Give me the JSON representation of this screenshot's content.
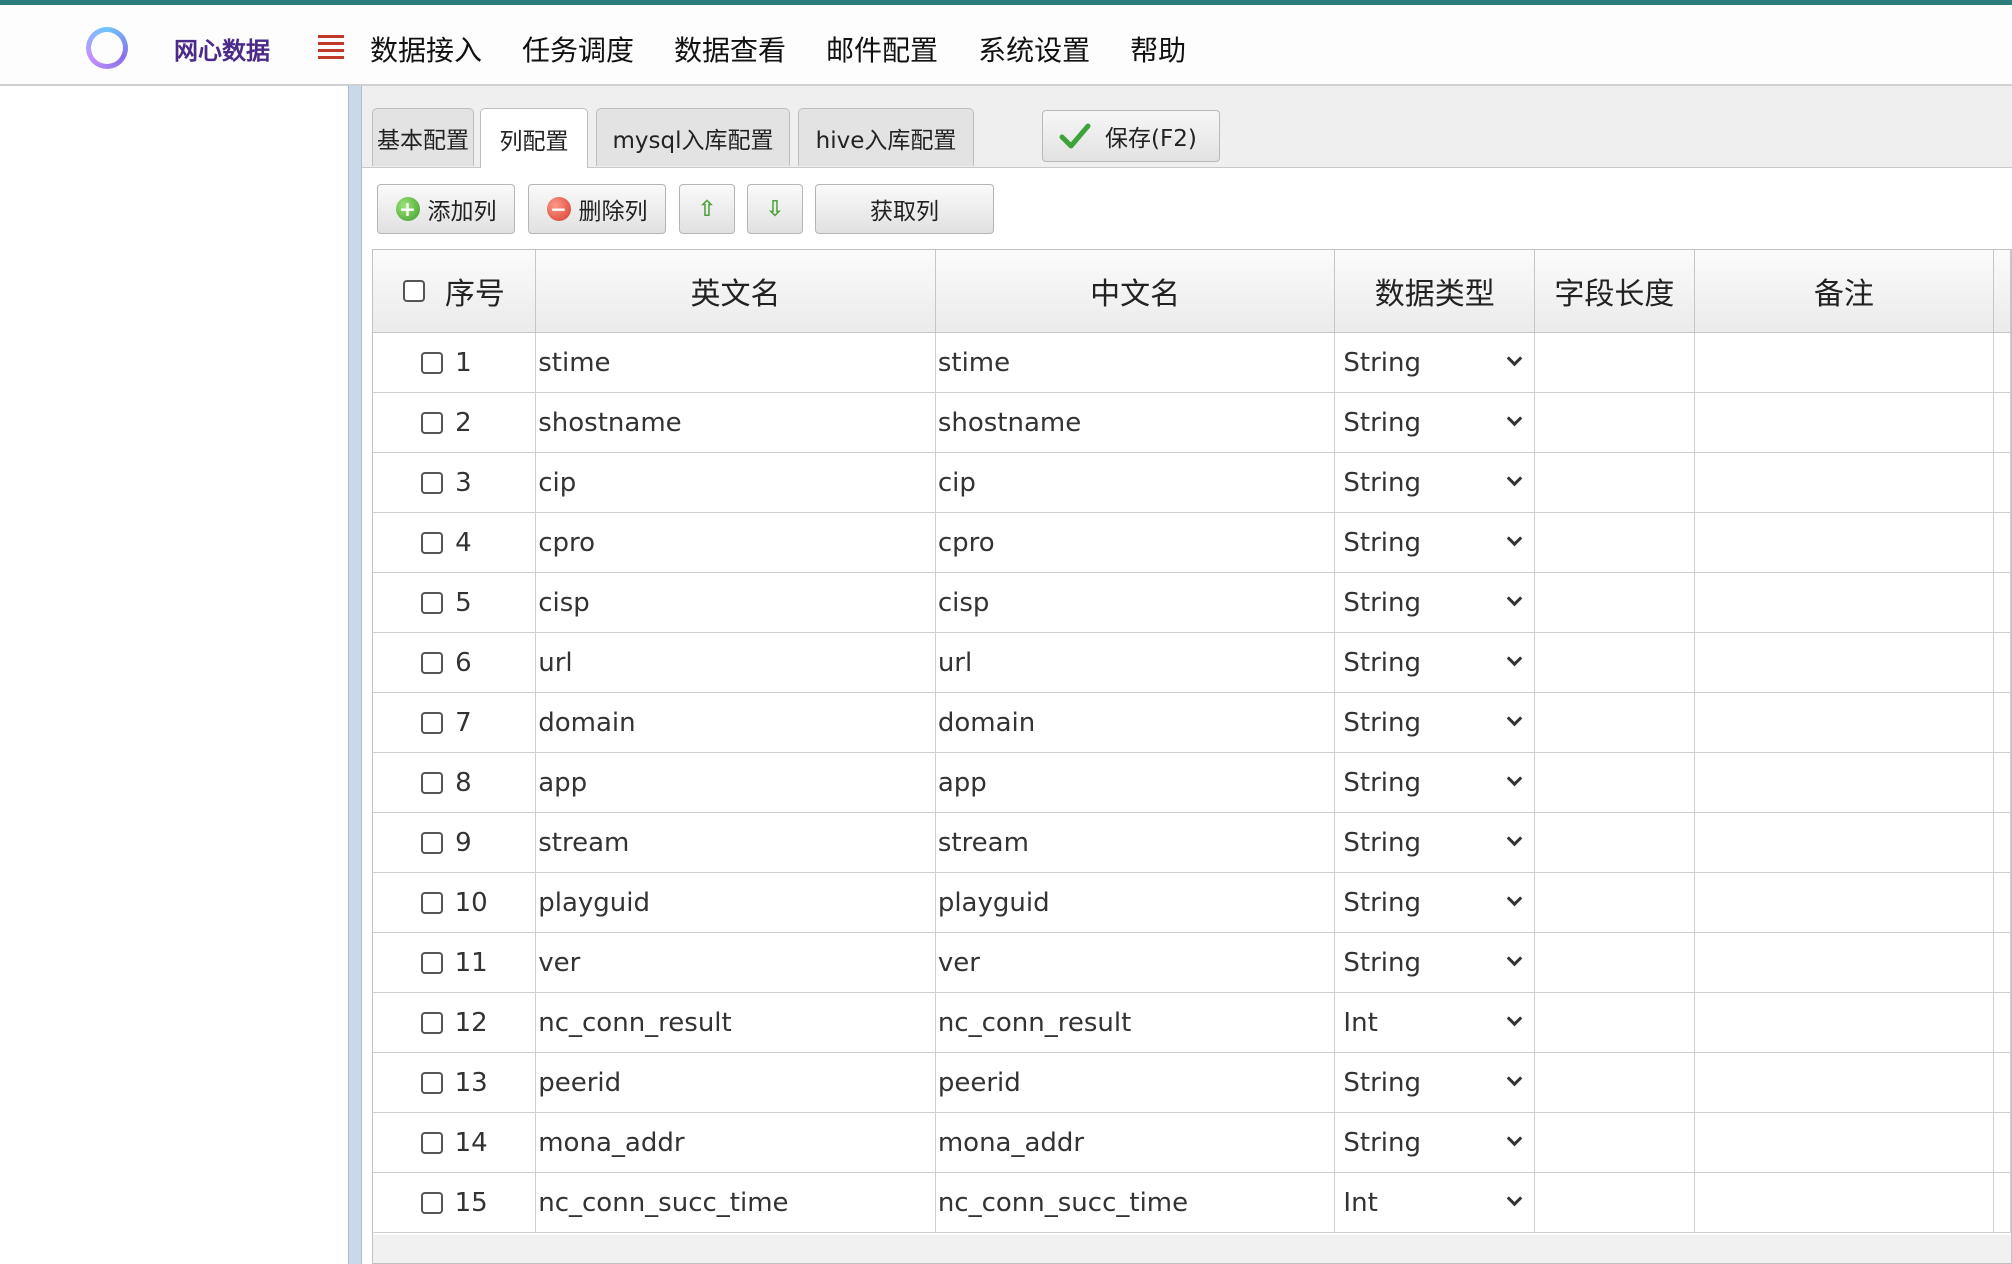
{
  "brand": "网心数据",
  "nav": [
    "数据接入",
    "任务调度",
    "数据查看",
    "邮件配置",
    "系统设置",
    "帮助"
  ],
  "tabs": [
    "基本配置",
    "列配置",
    "mysql入库配置",
    "hive入库配置"
  ],
  "active_tab": "列配置",
  "save_label": "保存(F2)",
  "toolbar": {
    "add_label": "添加列",
    "delete_label": "删除列",
    "fetch_label": "获取列"
  },
  "columns": [
    "序号",
    "英文名",
    "中文名",
    "数据类型",
    "字段长度",
    "备注"
  ],
  "rows": [
    {
      "seq": "1",
      "en": "stime",
      "cn": "stime",
      "type": "String",
      "length": "",
      "note": ""
    },
    {
      "seq": "2",
      "en": "shostname",
      "cn": "shostname",
      "type": "String",
      "length": "",
      "note": ""
    },
    {
      "seq": "3",
      "en": "cip",
      "cn": "cip",
      "type": "String",
      "length": "",
      "note": ""
    },
    {
      "seq": "4",
      "en": "cpro",
      "cn": "cpro",
      "type": "String",
      "length": "",
      "note": ""
    },
    {
      "seq": "5",
      "en": "cisp",
      "cn": "cisp",
      "type": "String",
      "length": "",
      "note": ""
    },
    {
      "seq": "6",
      "en": "url",
      "cn": "url",
      "type": "String",
      "length": "",
      "note": ""
    },
    {
      "seq": "7",
      "en": "domain",
      "cn": "domain",
      "type": "String",
      "length": "",
      "note": ""
    },
    {
      "seq": "8",
      "en": "app",
      "cn": "app",
      "type": "String",
      "length": "",
      "note": ""
    },
    {
      "seq": "9",
      "en": "stream",
      "cn": "stream",
      "type": "String",
      "length": "",
      "note": ""
    },
    {
      "seq": "10",
      "en": "playguid",
      "cn": "playguid",
      "type": "String",
      "length": "",
      "note": ""
    },
    {
      "seq": "11",
      "en": "ver",
      "cn": "ver",
      "type": "String",
      "length": "",
      "note": ""
    },
    {
      "seq": "12",
      "en": "nc_conn_result",
      "cn": "nc_conn_result",
      "type": "Int",
      "length": "",
      "note": ""
    },
    {
      "seq": "13",
      "en": "peerid",
      "cn": "peerid",
      "type": "String",
      "length": "",
      "note": ""
    },
    {
      "seq": "14",
      "en": "mona_addr",
      "cn": "mona_addr",
      "type": "String",
      "length": "",
      "note": ""
    },
    {
      "seq": "15",
      "en": "nc_conn_succ_time",
      "cn": "nc_conn_succ_time",
      "type": "Int",
      "length": "",
      "note": ""
    }
  ],
  "colors": {
    "brand": "#4b2a8a",
    "menu_icon": "#c0392b",
    "accent_check": "#3fa23a",
    "splitter": "#c9d9ea"
  },
  "icons": {
    "logo": "ring-logo-icon",
    "menu": "hamburger-menu-icon",
    "save": "checkmark-icon",
    "add": "plus-circle-icon",
    "delete": "minus-circle-icon",
    "up": "arrow-up-icon",
    "down": "arrow-down-icon",
    "dropdown": "chevron-down-icon"
  }
}
